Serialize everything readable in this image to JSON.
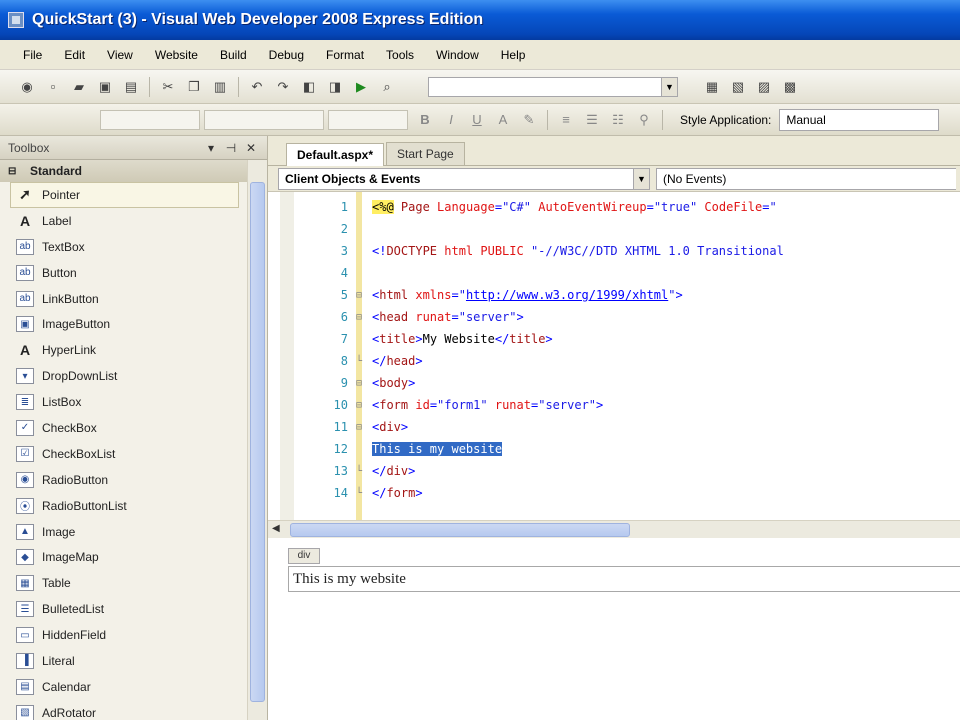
{
  "window": {
    "title": "QuickStart (3) - Visual Web Developer 2008 Express Edition"
  },
  "menu": [
    "File",
    "Edit",
    "View",
    "Website",
    "Build",
    "Debug",
    "Format",
    "Tools",
    "Window",
    "Help"
  ],
  "toolbar_format": {
    "style_application_label": "Style Application:",
    "style_application_value": "Manual"
  },
  "toolbox": {
    "title": "Toolbox",
    "category": "Standard",
    "items": [
      {
        "label": "Pointer",
        "icon": "pointer-icon"
      },
      {
        "label": "Label",
        "icon": "label-icon"
      },
      {
        "label": "TextBox",
        "icon": "textbox-icon"
      },
      {
        "label": "Button",
        "icon": "button-icon"
      },
      {
        "label": "LinkButton",
        "icon": "linkbutton-icon"
      },
      {
        "label": "ImageButton",
        "icon": "imagebutton-icon"
      },
      {
        "label": "HyperLink",
        "icon": "hyperlink-icon"
      },
      {
        "label": "DropDownList",
        "icon": "dropdownlist-icon"
      },
      {
        "label": "ListBox",
        "icon": "listbox-icon"
      },
      {
        "label": "CheckBox",
        "icon": "checkbox-icon"
      },
      {
        "label": "CheckBoxList",
        "icon": "checkboxlist-icon"
      },
      {
        "label": "RadioButton",
        "icon": "radiobutton-icon"
      },
      {
        "label": "RadioButtonList",
        "icon": "radiobuttonlist-icon"
      },
      {
        "label": "Image",
        "icon": "image-icon"
      },
      {
        "label": "ImageMap",
        "icon": "imagemap-icon"
      },
      {
        "label": "Table",
        "icon": "table-icon"
      },
      {
        "label": "BulletedList",
        "icon": "bulletedlist-icon"
      },
      {
        "label": "HiddenField",
        "icon": "hiddenfield-icon"
      },
      {
        "label": "Literal",
        "icon": "literal-icon"
      },
      {
        "label": "Calendar",
        "icon": "calendar-icon"
      },
      {
        "label": "AdRotator",
        "icon": "adrotator-icon"
      }
    ]
  },
  "document": {
    "tabs": [
      {
        "label": "Default.aspx*",
        "active": true
      },
      {
        "label": "Start Page",
        "active": false
      }
    ],
    "objects_combo": "Client Objects & Events",
    "events_combo": "(No Events)",
    "code_lines": [
      {
        "n": "1",
        "text": "<%@ Page Language=\"C#\" AutoEventWireup=\"true\"  CodeFile=\""
      },
      {
        "n": "2",
        "text": ""
      },
      {
        "n": "3",
        "text": "<!DOCTYPE html PUBLIC \"-//W3C//DTD XHTML 1.0 Transitional"
      },
      {
        "n": "4",
        "text": ""
      },
      {
        "n": "5",
        "text": "<html xmlns=\"http://www.w3.org/1999/xhtml\">"
      },
      {
        "n": "6",
        "text": "<head runat=\"server\">"
      },
      {
        "n": "7",
        "text": "    <title>My Website</title>"
      },
      {
        "n": "8",
        "text": "</head>"
      },
      {
        "n": "9",
        "text": "<body>"
      },
      {
        "n": "10",
        "text": "    <form id=\"form1\" runat=\"server\">"
      },
      {
        "n": "11",
        "text": "    <div>"
      },
      {
        "n": "12",
        "text": "    This is my website"
      },
      {
        "n": "13",
        "text": "    </div>"
      },
      {
        "n": "14",
        "text": "    </form>"
      }
    ],
    "design_tag": "div",
    "design_text": "This is my website"
  }
}
